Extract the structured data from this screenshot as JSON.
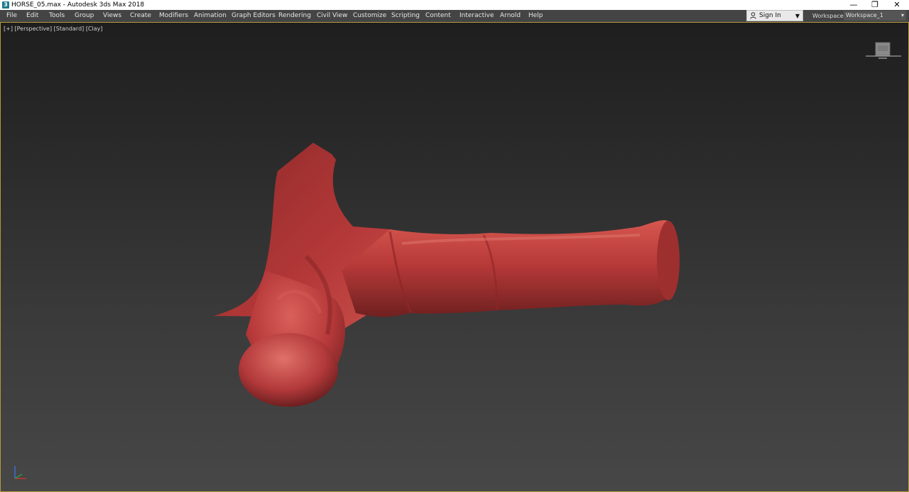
{
  "window": {
    "title": "HORSE_05.max - Autodesk 3ds Max 2018",
    "controls": {
      "minimize": "—",
      "restore": "❐",
      "close": "✕"
    }
  },
  "menubar": {
    "items": [
      {
        "label": "File"
      },
      {
        "label": "Edit"
      },
      {
        "label": "Tools"
      },
      {
        "label": "Group"
      },
      {
        "label": "Views"
      },
      {
        "label": "Create"
      },
      {
        "label": "Modifiers"
      },
      {
        "label": "Animation"
      },
      {
        "label": "Graph Editors"
      },
      {
        "label": "Rendering"
      },
      {
        "label": "Civil View"
      },
      {
        "label": "Customize"
      },
      {
        "label": "Scripting"
      },
      {
        "label": "Content"
      },
      {
        "label": "Interactive"
      },
      {
        "label": "Arnold"
      },
      {
        "label": "Help"
      }
    ]
  },
  "account": {
    "sign_in_label": "Sign In",
    "icon": "user-icon"
  },
  "workspaces": {
    "label": "Workspaces:",
    "selected": "Workspace_1"
  },
  "viewport": {
    "labels": [
      "[+]",
      "[Perspective]",
      "[Standard]",
      "[Clay]"
    ],
    "viewcube_icon": "viewcube-icon",
    "model_color": "#b7393a",
    "border_color": "#b59a3a"
  }
}
